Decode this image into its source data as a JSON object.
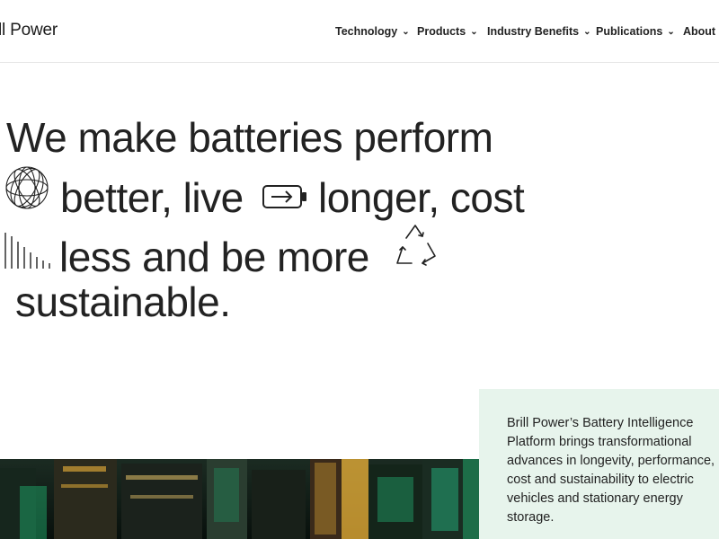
{
  "header": {
    "logo": "ll Power",
    "nav": [
      {
        "label": "Technology"
      },
      {
        "label": "Products"
      },
      {
        "label": "Industry Benefits"
      },
      {
        "label": "Publications"
      },
      {
        "label": "About"
      }
    ],
    "chevron": "⌄"
  },
  "hero": {
    "line1": "We make batteries perform",
    "line2a": "better, live",
    "line2b": "longer, cost",
    "line3": "less and be more",
    "line4": "sustainable."
  },
  "panel": {
    "text": "Brill Power’s Battery Intelligence Platform brings transformational advances in longevity, performance, cost and sustainability to electric vehicles and stationary energy storage."
  },
  "colors": {
    "panel_bg": "#e7f4ec",
    "text": "#222222",
    "photo_green": "#1f9a63",
    "photo_amber": "#f2b53a"
  },
  "icons": [
    "orbit-sphere-icon",
    "battery-arrow-icon",
    "bar-decline-icon",
    "recycle-arrows-icon"
  ]
}
